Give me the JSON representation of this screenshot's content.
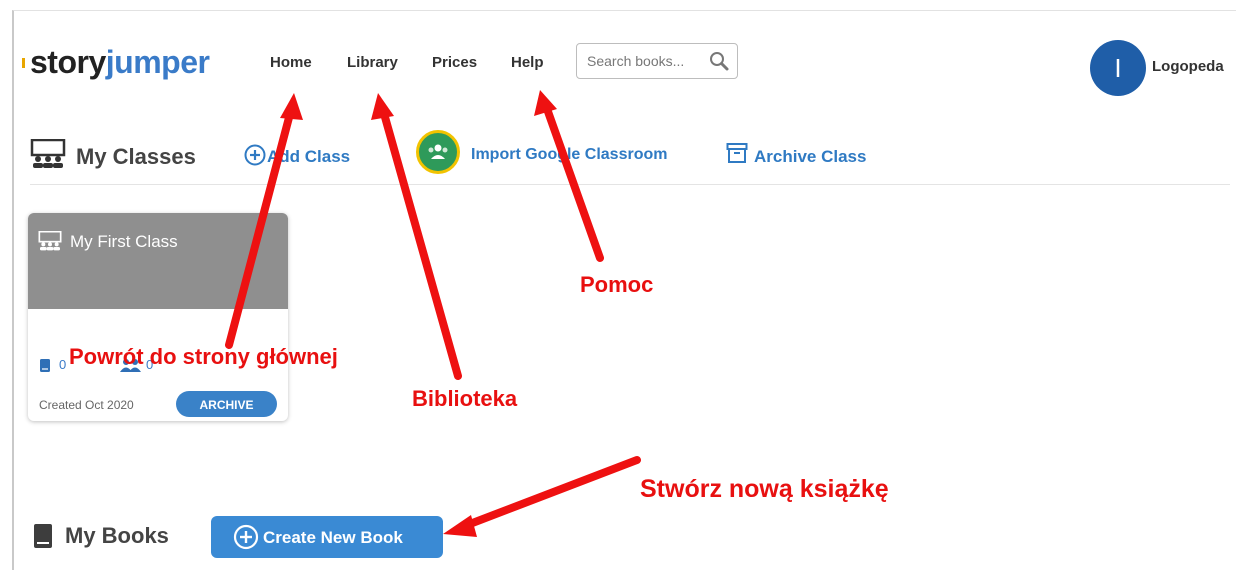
{
  "header": {
    "logo_story": "story",
    "logo_jumper": "jumper",
    "nav": {
      "home": "Home",
      "library": "Library",
      "prices": "Prices",
      "help": "Help"
    },
    "search": {
      "placeholder": "Search books...",
      "icon": "search-icon"
    },
    "user": {
      "avatar_initial": "I",
      "name": "Logopeda"
    }
  },
  "classes": {
    "title": "My Classes",
    "icon": "classroom-icon",
    "add_class": "Add Class",
    "import_google": "Import Google Classroom",
    "archive_class": "Archive Class"
  },
  "class_card": {
    "title": "My First Class",
    "books_count": "0",
    "students_count": "0",
    "created": "Created Oct 2020",
    "archive_label": "ARCHIVE"
  },
  "books": {
    "title": "My Books",
    "create_label": "Create New Book"
  },
  "annotations": {
    "home": "Powrót do strony głównej",
    "library": "Biblioteka",
    "help": "Pomoc",
    "create": "Stwórz nową książkę"
  },
  "colors": {
    "accent_blue": "#3a82c8",
    "annotation_red": "#e81010",
    "card_gray": "#8f8f8f",
    "google_green": "#2e9a5a"
  }
}
